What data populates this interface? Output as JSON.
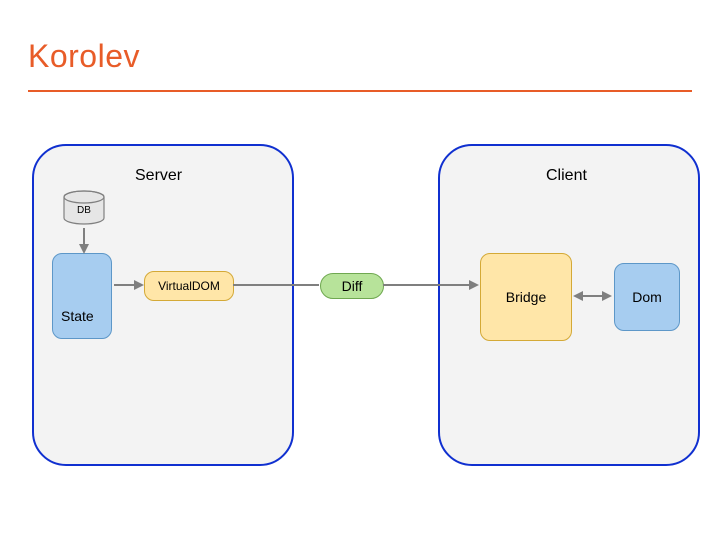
{
  "title": "Korolev",
  "server": {
    "label": "Server"
  },
  "client": {
    "label": "Client"
  },
  "db": {
    "label": "DB"
  },
  "state": {
    "label": "State"
  },
  "vdom": {
    "label": "VirtualDOM"
  },
  "diff": {
    "label": "Diff"
  },
  "bridge": {
    "label": "Bridge"
  },
  "dom": {
    "label": "Dom"
  },
  "colors": {
    "accent": "#e85c28",
    "panelBorder": "#1030d0",
    "panelFill": "#f3f3f3",
    "blueFill": "#a7cdf0",
    "amberFill": "#ffe6a8",
    "greenFill": "#b7e39a",
    "arrow": "#7f7f7f"
  }
}
